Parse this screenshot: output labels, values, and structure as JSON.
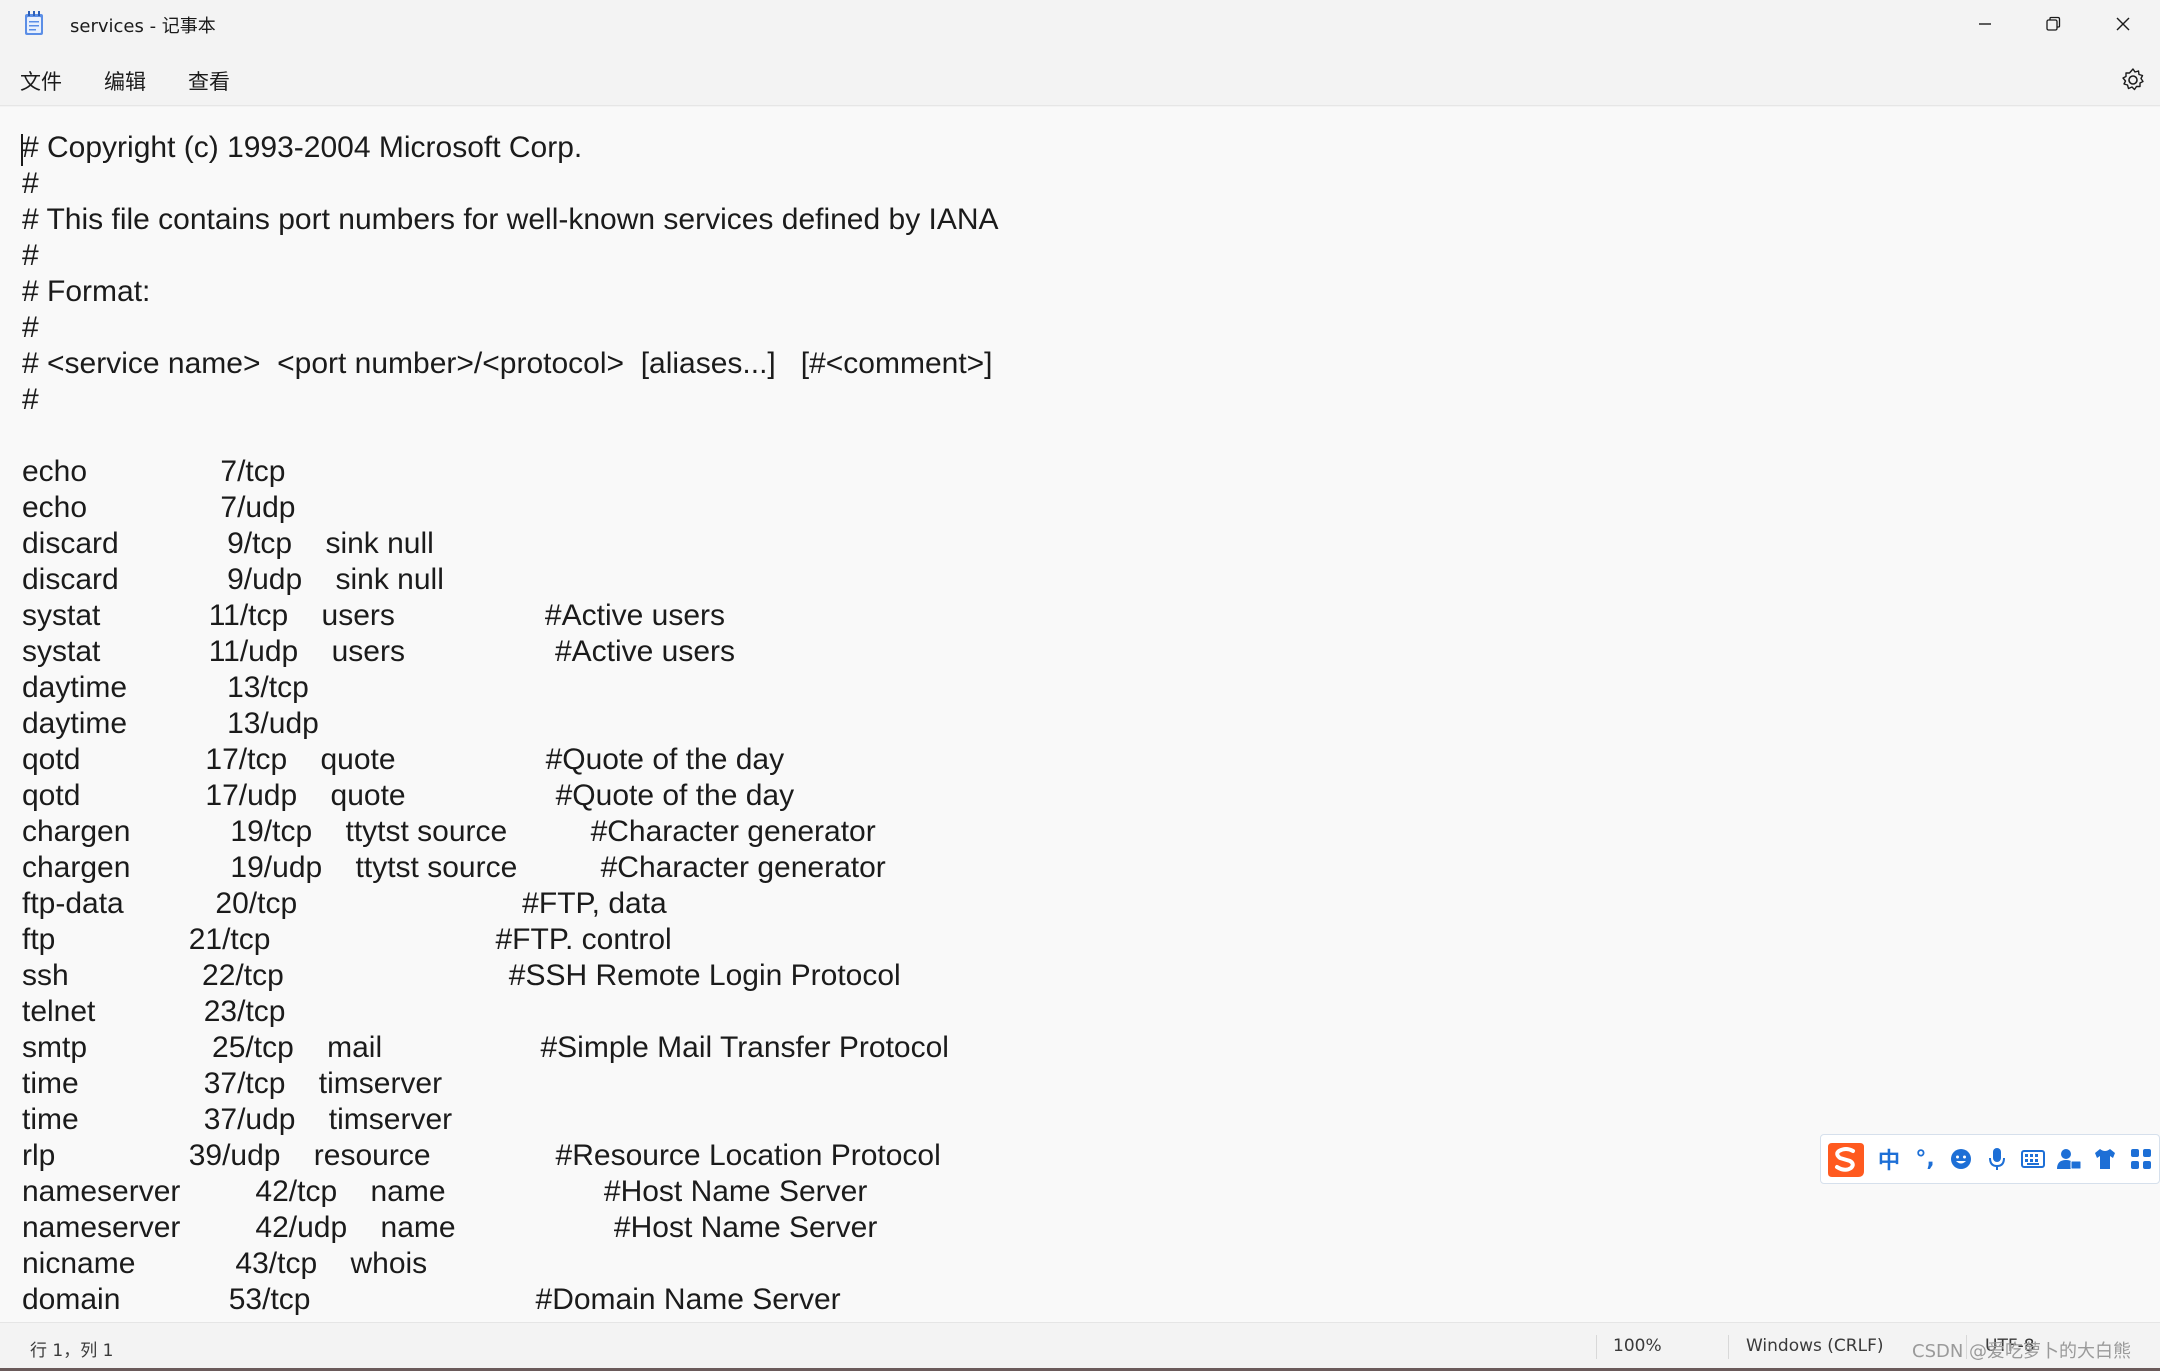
{
  "window": {
    "title": "services - 记事本"
  },
  "menu": {
    "file": "文件",
    "edit": "编辑",
    "view": "查看"
  },
  "editor": {
    "lines": [
      "# Copyright (c) 1993-2004 Microsoft Corp.",
      "#",
      "# This file contains port numbers for well-known services defined by IANA",
      "#",
      "# Format:",
      "#",
      "# <service name>  <port number>/<protocol>  [aliases...]   [#<comment>]",
      "#",
      "",
      "echo                7/tcp",
      "echo                7/udp",
      "discard             9/tcp    sink null",
      "discard             9/udp    sink null",
      "systat             11/tcp    users                  #Active users",
      "systat             11/udp    users                  #Active users",
      "daytime            13/tcp",
      "daytime            13/udp",
      "qotd               17/tcp    quote                  #Quote of the day",
      "qotd               17/udp    quote                  #Quote of the day",
      "chargen            19/tcp    ttytst source          #Character generator",
      "chargen            19/udp    ttytst source          #Character generator",
      "ftp-data           20/tcp                           #FTP, data",
      "ftp                21/tcp                           #FTP. control",
      "ssh                22/tcp                           #SSH Remote Login Protocol",
      "telnet             23/tcp",
      "smtp               25/tcp    mail                   #Simple Mail Transfer Protocol",
      "time               37/tcp    timserver",
      "time               37/udp    timserver",
      "rlp                39/udp    resource               #Resource Location Protocol",
      "nameserver         42/tcp    name                   #Host Name Server",
      "nameserver         42/udp    name                   #Host Name Server",
      "nicname            43/tcp    whois",
      "domain             53/tcp                           #Domain Name Server"
    ]
  },
  "ime": {
    "lang": "中",
    "punct": "°,"
  },
  "status": {
    "position": "行 1，列 1",
    "zoom": "100%",
    "eol": "Windows (CRLF)",
    "encoding": "UTF-8",
    "watermark": "CSDN @爱吃萝卜的大白熊"
  }
}
